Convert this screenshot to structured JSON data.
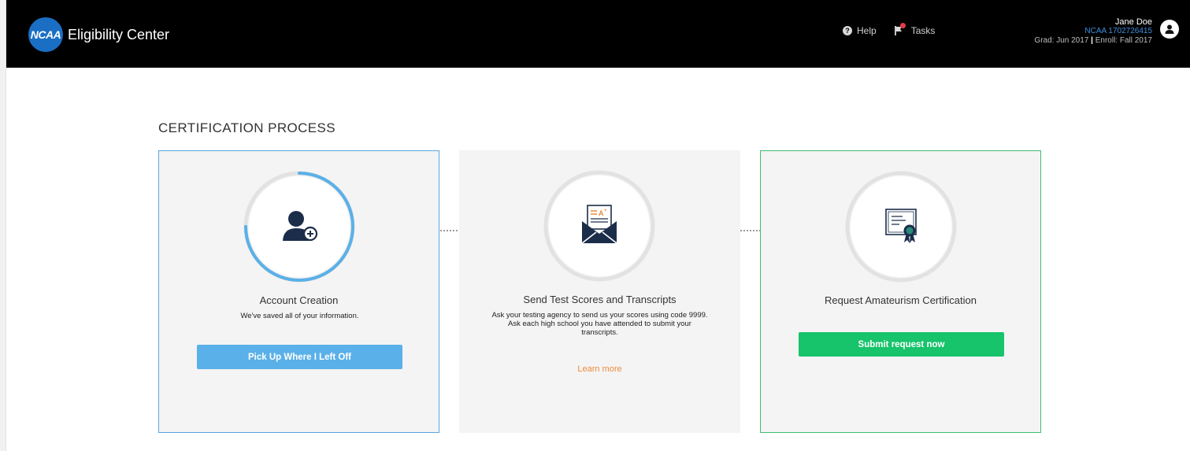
{
  "header": {
    "logo_text": "NCAA",
    "brand_name": "Eligibility Center",
    "help_label": "Help",
    "tasks_label": "Tasks",
    "user": {
      "name": "Jane Doe",
      "ncaa_id": "NCAA 1702726415",
      "grad": "Grad: Jun 2017",
      "separator": "|",
      "enroll": "Enroll: Fall 2017"
    }
  },
  "main": {
    "title": "CERTIFICATION PROCESS",
    "steps": [
      {
        "title": "Account Creation",
        "description": "We've saved all of your information.",
        "button_label": "Pick Up Where I Left Off",
        "icon": "add-user-icon",
        "progress": 0.75
      },
      {
        "title": "Send Test Scores and Transcripts",
        "description": "Ask your testing agency to send us your scores using code 9999. Ask each high school you have attended to submit your transcripts.",
        "link_label": "Learn more",
        "icon": "envelope-letter-icon"
      },
      {
        "title": "Request Amateurism Certification",
        "button_label": "Submit request now",
        "icon": "certificate-icon"
      }
    ]
  },
  "colors": {
    "header_bg": "#000000",
    "accent_blue": "#5ab0e8",
    "accent_green": "#17c36b",
    "link_orange": "#ee8a3a",
    "icon_navy": "#1c2d4a",
    "card_bg": "#f4f4f4"
  }
}
